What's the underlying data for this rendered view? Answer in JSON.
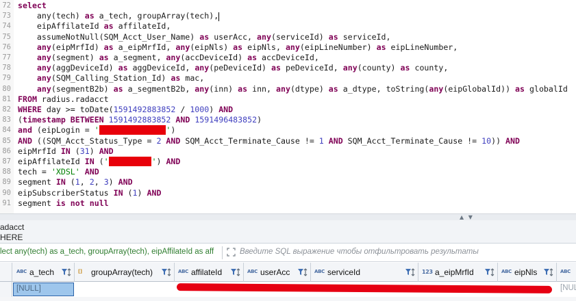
{
  "editor": {
    "lines": [
      {
        "n": "72",
        "segs": [
          {
            "t": "select",
            "c": "kw"
          }
        ]
      },
      {
        "n": "73",
        "segs": [
          {
            "t": "    any(tech) ",
            "c": ""
          },
          {
            "t": "as",
            "c": "kw"
          },
          {
            "t": " a_tech, groupArray(tech),",
            "c": ""
          },
          {
            "t": "|",
            "c": "cursor"
          }
        ]
      },
      {
        "n": "74",
        "segs": [
          {
            "t": "    eipAffilateId ",
            "c": ""
          },
          {
            "t": "as",
            "c": "kw"
          },
          {
            "t": " affilateId,",
            "c": ""
          }
        ]
      },
      {
        "n": "75",
        "segs": [
          {
            "t": "    assumeNotNull(SQM_Acct_User_Name) ",
            "c": ""
          },
          {
            "t": "as",
            "c": "kw"
          },
          {
            "t": " userAcc, ",
            "c": ""
          },
          {
            "t": "any",
            "c": "kw"
          },
          {
            "t": "(serviceId) ",
            "c": ""
          },
          {
            "t": "as",
            "c": "kw"
          },
          {
            "t": " serviceId,",
            "c": ""
          }
        ]
      },
      {
        "n": "76",
        "segs": [
          {
            "t": "    ",
            "c": ""
          },
          {
            "t": "any",
            "c": "kw"
          },
          {
            "t": "(eipMrfId) ",
            "c": ""
          },
          {
            "t": "as",
            "c": "kw"
          },
          {
            "t": " a_eipMrfId, ",
            "c": ""
          },
          {
            "t": "any",
            "c": "kw"
          },
          {
            "t": "(eipNls) ",
            "c": ""
          },
          {
            "t": "as",
            "c": "kw"
          },
          {
            "t": " eipNls, ",
            "c": ""
          },
          {
            "t": "any",
            "c": "kw"
          },
          {
            "t": "(eipLineNumber) ",
            "c": ""
          },
          {
            "t": "as",
            "c": "kw"
          },
          {
            "t": " eipLineNumber,",
            "c": ""
          }
        ]
      },
      {
        "n": "77",
        "segs": [
          {
            "t": "    ",
            "c": ""
          },
          {
            "t": "any",
            "c": "kw"
          },
          {
            "t": "(segment) ",
            "c": ""
          },
          {
            "t": "as",
            "c": "kw"
          },
          {
            "t": " a_segment, ",
            "c": ""
          },
          {
            "t": "any",
            "c": "kw"
          },
          {
            "t": "(accDeviceId) ",
            "c": ""
          },
          {
            "t": "as",
            "c": "kw"
          },
          {
            "t": " accDeviceId,",
            "c": ""
          }
        ]
      },
      {
        "n": "78",
        "segs": [
          {
            "t": "    ",
            "c": ""
          },
          {
            "t": "any",
            "c": "kw"
          },
          {
            "t": "(aggDeviceId) ",
            "c": ""
          },
          {
            "t": "as",
            "c": "kw"
          },
          {
            "t": " aggDeviceId, ",
            "c": ""
          },
          {
            "t": "any",
            "c": "kw"
          },
          {
            "t": "(peDeviceId) ",
            "c": ""
          },
          {
            "t": "as",
            "c": "kw"
          },
          {
            "t": " peDeviceId, ",
            "c": ""
          },
          {
            "t": "any",
            "c": "kw"
          },
          {
            "t": "(county) ",
            "c": ""
          },
          {
            "t": "as",
            "c": "kw"
          },
          {
            "t": " county,",
            "c": ""
          }
        ]
      },
      {
        "n": "79",
        "segs": [
          {
            "t": "    ",
            "c": ""
          },
          {
            "t": "any",
            "c": "kw"
          },
          {
            "t": "(SQM_Calling_Station_Id) ",
            "c": ""
          },
          {
            "t": "as",
            "c": "kw"
          },
          {
            "t": " mac,",
            "c": ""
          }
        ]
      },
      {
        "n": "80",
        "segs": [
          {
            "t": "    ",
            "c": ""
          },
          {
            "t": "any",
            "c": "kw"
          },
          {
            "t": "(segmentB2b) ",
            "c": ""
          },
          {
            "t": "as",
            "c": "kw"
          },
          {
            "t": " a_segmentB2b, ",
            "c": ""
          },
          {
            "t": "any",
            "c": "kw"
          },
          {
            "t": "(inn) ",
            "c": ""
          },
          {
            "t": "as",
            "c": "kw"
          },
          {
            "t": " inn, ",
            "c": ""
          },
          {
            "t": "any",
            "c": "kw"
          },
          {
            "t": "(dtype) ",
            "c": ""
          },
          {
            "t": "as",
            "c": "kw"
          },
          {
            "t": " a_dtype, toString(",
            "c": ""
          },
          {
            "t": "any",
            "c": "kw"
          },
          {
            "t": "(eipGlobalId)) ",
            "c": ""
          },
          {
            "t": "as",
            "c": "kw"
          },
          {
            "t": " globalId",
            "c": ""
          }
        ]
      },
      {
        "n": "81",
        "segs": [
          {
            "t": "FROM",
            "c": "kw"
          },
          {
            "t": " radius.radacct",
            "c": ""
          }
        ]
      },
      {
        "n": "82",
        "segs": [
          {
            "t": "WHERE",
            "c": "kw"
          },
          {
            "t": " day >= toDate(",
            "c": ""
          },
          {
            "t": "1591492883852",
            "c": "num"
          },
          {
            "t": " / ",
            "c": ""
          },
          {
            "t": "1000",
            "c": "num"
          },
          {
            "t": ") ",
            "c": ""
          },
          {
            "t": "AND",
            "c": "kw"
          }
        ]
      },
      {
        "n": "83",
        "segs": [
          {
            "t": "(",
            "c": ""
          },
          {
            "t": "timestamp",
            "c": "kw"
          },
          {
            "t": " ",
            "c": ""
          },
          {
            "t": "BETWEEN",
            "c": "kw"
          },
          {
            "t": " ",
            "c": ""
          },
          {
            "t": "1591492883852",
            "c": "num"
          },
          {
            "t": " ",
            "c": ""
          },
          {
            "t": "AND",
            "c": "kw"
          },
          {
            "t": " ",
            "c": ""
          },
          {
            "t": "1591496483852",
            "c": "num"
          },
          {
            "t": ")",
            "c": ""
          }
        ]
      },
      {
        "n": "84",
        "segs": [
          {
            "t": "and",
            "c": "kw"
          },
          {
            "t": " (eipLogin = ",
            "c": ""
          },
          {
            "t": "'",
            "c": "strg"
          },
          {
            "t": "              ",
            "c": "redact"
          },
          {
            "t": "'",
            "c": "strg"
          },
          {
            "t": ")",
            "c": ""
          }
        ]
      },
      {
        "n": "85",
        "segs": [
          {
            "t": "AND",
            "c": "kw"
          },
          {
            "t": " ((SQM_Acct_Status_Type = ",
            "c": ""
          },
          {
            "t": "2",
            "c": "num"
          },
          {
            "t": " ",
            "c": ""
          },
          {
            "t": "AND",
            "c": "kw"
          },
          {
            "t": " SQM_Acct_Terminate_Cause != ",
            "c": ""
          },
          {
            "t": "1",
            "c": "num"
          },
          {
            "t": " ",
            "c": ""
          },
          {
            "t": "AND",
            "c": "kw"
          },
          {
            "t": " SQM_Acct_Terminate_Cause != ",
            "c": ""
          },
          {
            "t": "10",
            "c": "num"
          },
          {
            "t": ")) ",
            "c": ""
          },
          {
            "t": "AND",
            "c": "kw"
          }
        ]
      },
      {
        "n": "86",
        "segs": [
          {
            "t": "eipMrfId ",
            "c": ""
          },
          {
            "t": "IN",
            "c": "kw"
          },
          {
            "t": " (",
            "c": ""
          },
          {
            "t": "31",
            "c": "num"
          },
          {
            "t": ") ",
            "c": ""
          },
          {
            "t": "AND",
            "c": "kw"
          }
        ]
      },
      {
        "n": "87",
        "segs": [
          {
            "t": "eipAffilateId ",
            "c": ""
          },
          {
            "t": "IN",
            "c": "kw"
          },
          {
            "t": " (",
            "c": ""
          },
          {
            "t": "'",
            "c": "strg"
          },
          {
            "t": "         ",
            "c": "redact"
          },
          {
            "t": "'",
            "c": "strg"
          },
          {
            "t": ") ",
            "c": ""
          },
          {
            "t": "AND",
            "c": "kw"
          }
        ]
      },
      {
        "n": "88",
        "segs": [
          {
            "t": "tech = ",
            "c": ""
          },
          {
            "t": "'XDSL'",
            "c": "strg"
          },
          {
            "t": " ",
            "c": ""
          },
          {
            "t": "AND",
            "c": "kw"
          }
        ]
      },
      {
        "n": "89",
        "segs": [
          {
            "t": "segment ",
            "c": ""
          },
          {
            "t": "IN",
            "c": "kw"
          },
          {
            "t": " (",
            "c": ""
          },
          {
            "t": "1",
            "c": "num"
          },
          {
            "t": ", ",
            "c": ""
          },
          {
            "t": "2",
            "c": "num"
          },
          {
            "t": ", ",
            "c": ""
          },
          {
            "t": "3",
            "c": "num"
          },
          {
            "t": ") ",
            "c": ""
          },
          {
            "t": "AND",
            "c": "kw"
          }
        ]
      },
      {
        "n": "90",
        "segs": [
          {
            "t": "eipSubscriberStatus ",
            "c": ""
          },
          {
            "t": "IN",
            "c": "kw"
          },
          {
            "t": " (",
            "c": ""
          },
          {
            "t": "1",
            "c": "num"
          },
          {
            "t": ") ",
            "c": ""
          },
          {
            "t": "AND",
            "c": "kw"
          }
        ]
      },
      {
        "n": "91",
        "segs": [
          {
            "t": "segment ",
            "c": ""
          },
          {
            "t": "is",
            "c": "kw"
          },
          {
            "t": " ",
            "c": ""
          },
          {
            "t": "not",
            "c": "kw"
          },
          {
            "t": " ",
            "c": ""
          },
          {
            "t": "null",
            "c": "kw"
          }
        ]
      }
    ]
  },
  "result_tab": {
    "line1": "adacct",
    "line2": "HERE"
  },
  "filter_bar": {
    "query_text": "lect any(tech) as a_tech, groupArray(tech), eipAffilateId as aff",
    "placeholder": "Введите SQL выражение чтобы отфильтровать результаты"
  },
  "grid": {
    "columns": [
      {
        "label": "a_tech",
        "type": "ABC",
        "type_kind": "str"
      },
      {
        "label": "groupArray(tech)",
        "type": "[]",
        "type_kind": "arr"
      },
      {
        "label": "affilateId",
        "type": "ABC",
        "type_kind": "str"
      },
      {
        "label": "userAcc",
        "type": "ABC",
        "type_kind": "str"
      },
      {
        "label": "serviceId",
        "type": "ABC",
        "type_kind": "str"
      },
      {
        "label": "a_eipMrfId",
        "type": "123",
        "type_kind": "num"
      },
      {
        "label": "eipNls",
        "type": "ABC",
        "type_kind": "str"
      },
      {
        "label": "",
        "type": "ABC",
        "type_kind": "str"
      }
    ],
    "row": {
      "a_tech": "[NULL]",
      "last_visible": "[NUL"
    }
  },
  "colors": {
    "keyword": "#7f0055",
    "string": "#008000",
    "number": "#3f3fbf",
    "selection": "#9ec6ec",
    "redaction": "#e60012"
  }
}
